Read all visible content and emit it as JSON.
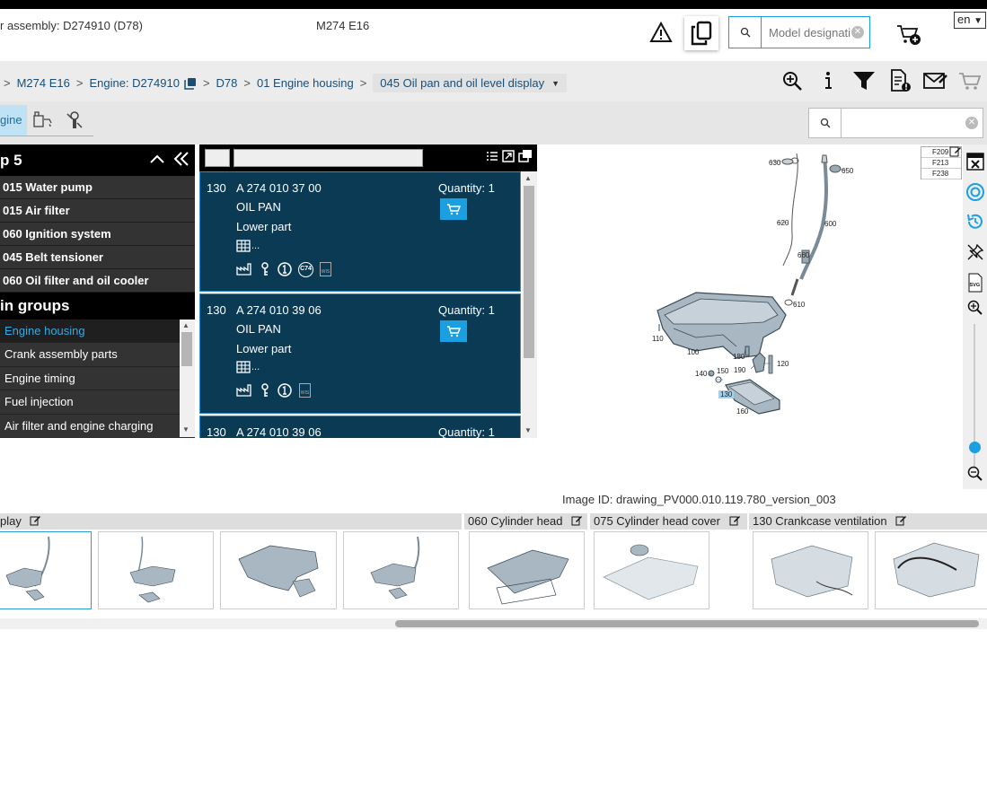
{
  "header": {
    "assembly_text": "r assembly: D274910 (D78)",
    "engine_code": "M274 E16",
    "search_placeholder": "Model designati",
    "language": "en"
  },
  "breadcrumb": {
    "items": [
      "M274 E16",
      "Engine: D274910",
      "D78",
      "01 Engine housing"
    ],
    "current": "045 Oil pan and oil level display"
  },
  "tabs": {
    "active_label": "gine"
  },
  "left_panel": {
    "top_title": "p 5",
    "recent_items": [
      "015 Water pump",
      "015 Air filter",
      "060 Ignition system",
      "045 Belt tensioner",
      "060 Oil filter and oil cooler"
    ],
    "groups_title": "in groups",
    "groups": [
      "Engine housing",
      "Crank assembly parts",
      "Engine timing",
      "Fuel injection",
      "Air filter and engine charging"
    ]
  },
  "parts": [
    {
      "pos": "130",
      "number": "A 274 010 37 00",
      "name": "OIL PAN",
      "desc": "Lower part",
      "qty_label": "Quantity: 1",
      "table_suffix": "..."
    },
    {
      "pos": "130",
      "number": "A 274 010 39 06",
      "name": "OIL PAN",
      "desc": "Lower part",
      "qty_label": "Quantity: 1",
      "table_suffix": "..."
    },
    {
      "pos": "130",
      "number": "A 274 010 39 06",
      "qty_label": "Quantity: 1"
    }
  ],
  "part_badges": {
    "c74": "C74",
    "wis": "WIS"
  },
  "drawing": {
    "labels": [
      "630",
      "650",
      "620",
      "600",
      "660",
      "610",
      "110",
      "100",
      "180",
      "190",
      "150",
      "140",
      "120",
      "130",
      "160"
    ],
    "footnotes": [
      "F209",
      "F213",
      "F238"
    ],
    "svg_badge": "SVG"
  },
  "image_id": "Image ID: drawing_PV000.010.119.780_version_003",
  "thumb_groups": [
    "play",
    "060 Cylinder head",
    "075 Cylinder head cover",
    "130 Crankcase ventilation"
  ],
  "colors": {
    "accent": "#1a9fe0",
    "part_bg": "#0b3a55",
    "highlight": "#3aa7e0"
  }
}
